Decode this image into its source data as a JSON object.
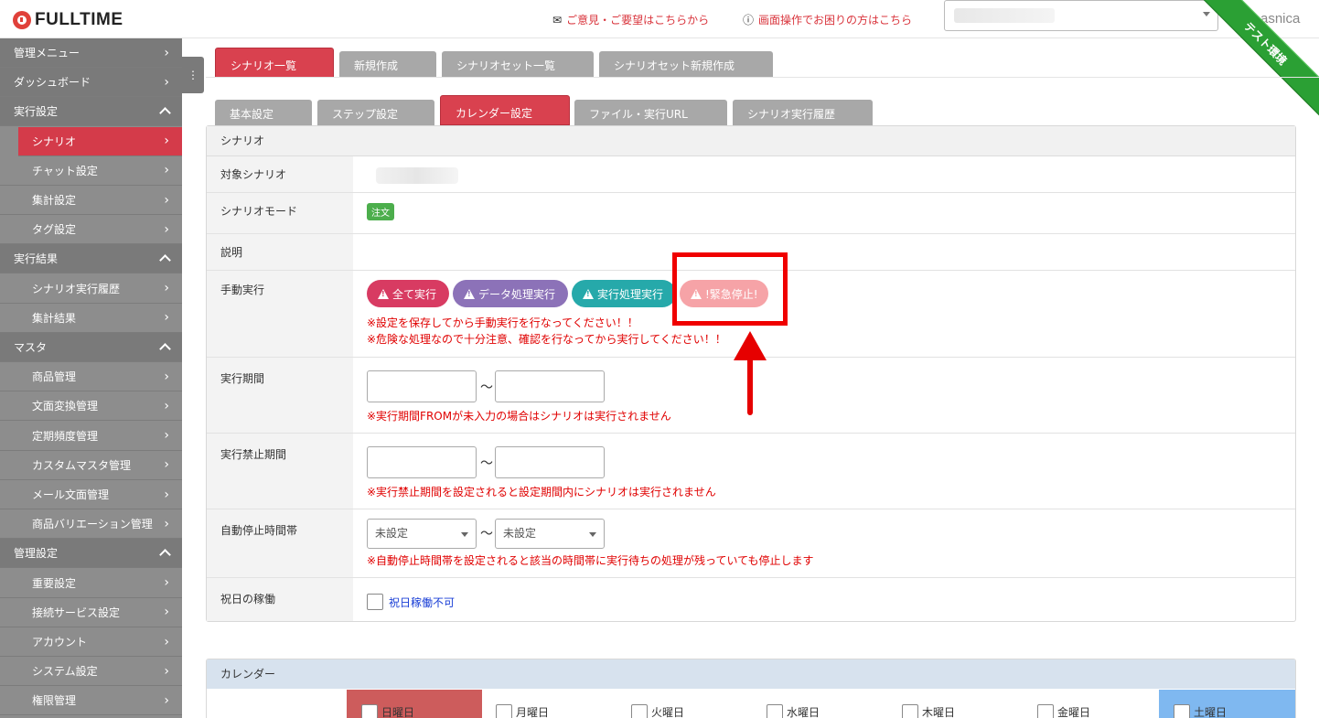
{
  "header": {
    "logo_text": "FULLTIME",
    "feedback_link": "ご意見・ご要望はこちらから",
    "help_link": "画面操作でお困りの方はこちら",
    "username": "asnica",
    "env_ribbon": "テスト環境"
  },
  "sidebar": {
    "items": [
      {
        "label": "管理メニュー",
        "type": "head-link"
      },
      {
        "label": "ダッシュボード",
        "type": "head-link"
      },
      {
        "label": "実行設定",
        "type": "section"
      },
      {
        "label": "シナリオ",
        "type": "active"
      },
      {
        "label": "チャット設定",
        "type": "sub"
      },
      {
        "label": "集計設定",
        "type": "sub"
      },
      {
        "label": "タグ設定",
        "type": "sub"
      },
      {
        "label": "実行結果",
        "type": "section"
      },
      {
        "label": "シナリオ実行履歴",
        "type": "sub"
      },
      {
        "label": "集計結果",
        "type": "sub"
      },
      {
        "label": "マスタ",
        "type": "section"
      },
      {
        "label": "商品管理",
        "type": "sub"
      },
      {
        "label": "文面変換管理",
        "type": "sub"
      },
      {
        "label": "定期頻度管理",
        "type": "sub"
      },
      {
        "label": "カスタムマスタ管理",
        "type": "sub"
      },
      {
        "label": "メール文面管理",
        "type": "sub"
      },
      {
        "label": "商品バリエーション管理",
        "type": "sub"
      },
      {
        "label": "管理設定",
        "type": "section"
      },
      {
        "label": "重要設定",
        "type": "sub"
      },
      {
        "label": "接続サービス設定",
        "type": "sub"
      },
      {
        "label": "アカウント",
        "type": "sub"
      },
      {
        "label": "システム設定",
        "type": "sub"
      },
      {
        "label": "権限管理",
        "type": "sub"
      }
    ]
  },
  "top_tabs": [
    "シナリオ一覧",
    "新規作成",
    "シナリオセット一覧",
    "シナリオセット新規作成"
  ],
  "sub_tabs": [
    "基本設定",
    "ステップ設定",
    "カレンダー設定",
    "ファイル・実行URL",
    "シナリオ実行履歴"
  ],
  "panel": {
    "title": "シナリオ",
    "target_label": "対象シナリオ",
    "mode_label": "シナリオモード",
    "mode_badge": "注文",
    "desc_label": "説明",
    "manual_label": "手動実行",
    "buttons": {
      "run_all": "全て実行",
      "data_run": "データ処理実行",
      "exec_run": "実行処理実行",
      "emergency": "!緊急停止!"
    },
    "manual_note1": "※設定を保存してから手動実行を行なってください！！",
    "manual_note2": "※危険な処理なので十分注意、確認を行なってから実行してください！！",
    "period_label": "実行期間",
    "tilde": "〜",
    "period_note": "※実行期間FROMが未入力の場合はシナリオは実行されません",
    "ban_label": "実行禁止期間",
    "ban_note": "※実行禁止期間を設定されると設定期間内にシナリオは実行されません",
    "auto_stop_label": "自動停止時間帯",
    "auto_stop_from": "未設定",
    "auto_stop_to": "未設定",
    "auto_stop_note": "※自動停止時間帯を設定されると該当の時間帯に実行待ちの処理が残っていても停止します",
    "holiday_label": "祝日の稼働",
    "holiday_check": "祝日稼働不可"
  },
  "calendar": {
    "title": "カレンダー",
    "days": [
      "日曜日",
      "月曜日",
      "火曜日",
      "水曜日",
      "木曜日",
      "金曜日",
      "土曜日"
    ]
  },
  "colors": {
    "accent": "#d9414f",
    "note_red": "#e00000",
    "ribbon_green": "#2ba034",
    "sunday": "#cd5c5c",
    "saturday": "#7fb8f0"
  }
}
